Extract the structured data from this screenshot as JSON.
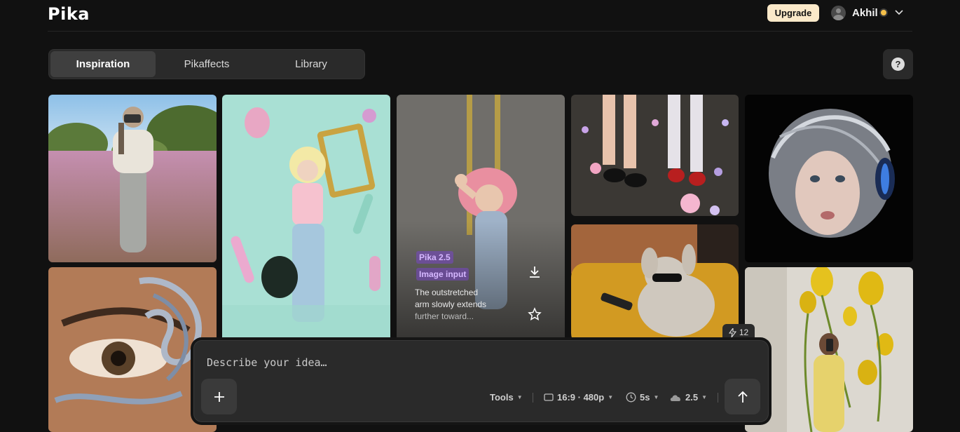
{
  "header": {
    "logo": "Pika",
    "upgrade_label": "Upgrade",
    "user_name": "Akhil"
  },
  "tabs": [
    {
      "label": "Inspiration",
      "active": true
    },
    {
      "label": "Pikaffects",
      "active": false
    },
    {
      "label": "Library",
      "active": false
    }
  ],
  "help_label": "?",
  "featured_card": {
    "model_badge": "Pika 2.5",
    "type_badge": "Image input",
    "description_line1": "The outstretched",
    "description_line2": "arm slowly extends",
    "description_line3": "further toward..."
  },
  "credits_chip": "12",
  "prompt": {
    "placeholder": "Describe your idea…",
    "tools_label": "Tools",
    "aspect_label": "16:9 · 480p",
    "duration_label": "5s",
    "model_label": "2.5"
  },
  "colors": {
    "background": "#111111",
    "upgrade_bg": "#fbe9c9",
    "badge_purple": "#d6b8ff",
    "credit_dot": "#f5c04a"
  }
}
